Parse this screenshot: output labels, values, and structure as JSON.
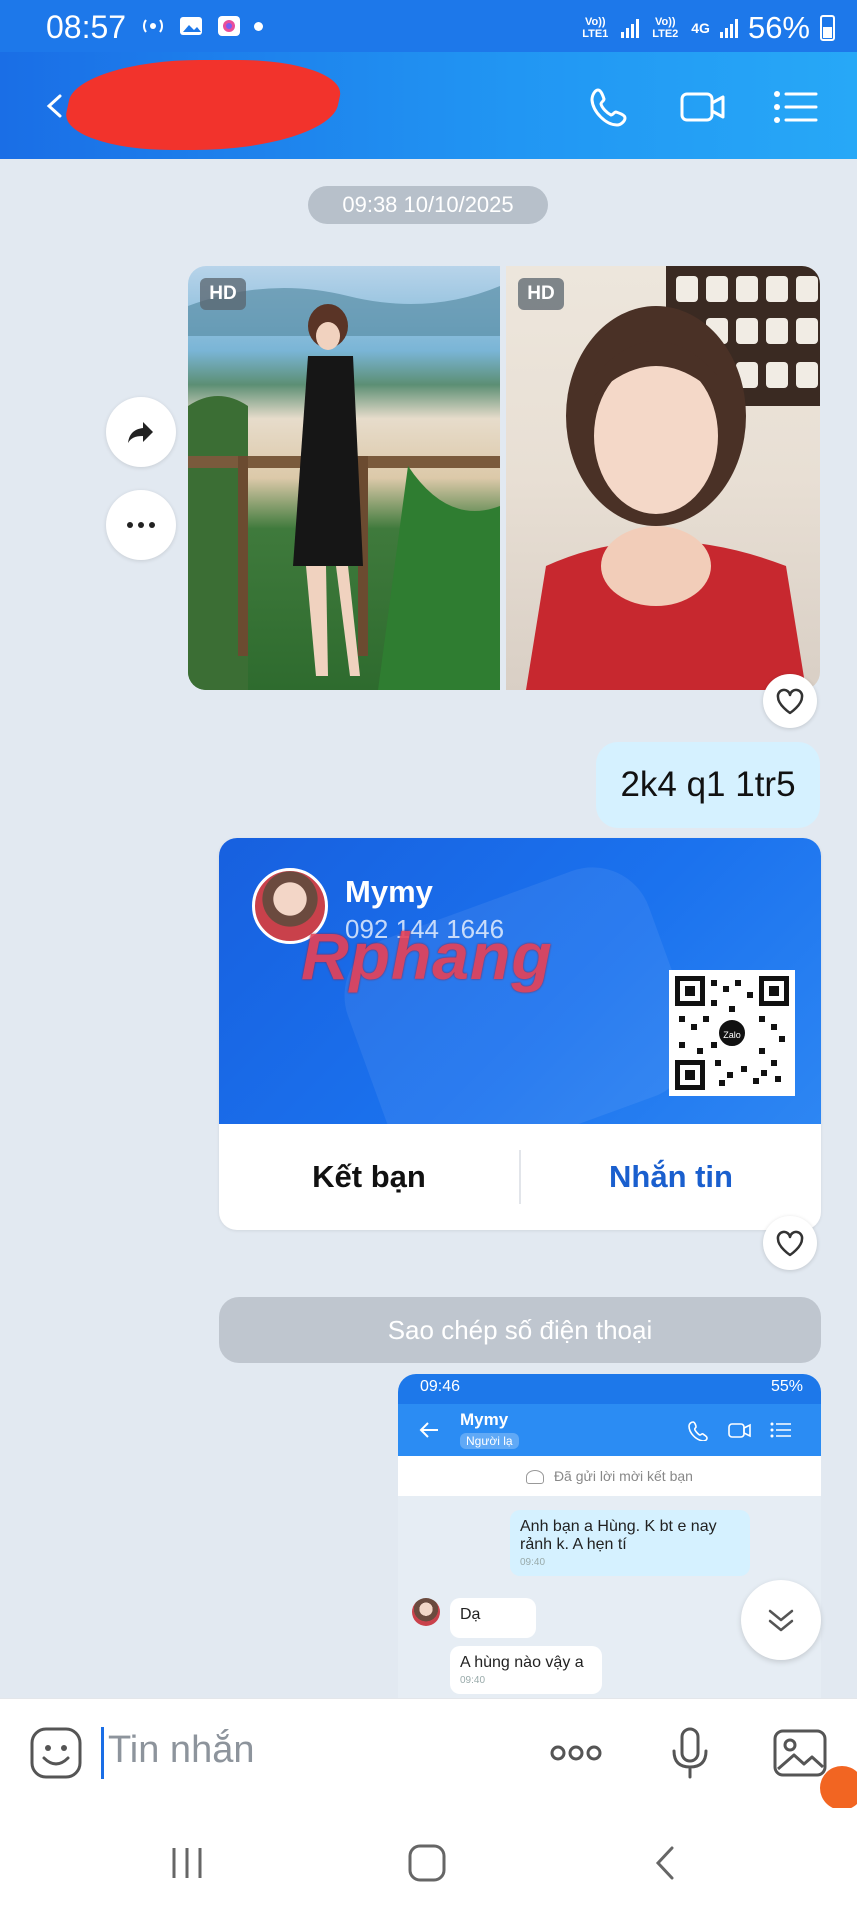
{
  "status_bar": {
    "time": "08:57",
    "sim1_label": "Vo)) LTE1",
    "sim2_label": "Vo)) LTE2",
    "network": "4G",
    "battery": "56%"
  },
  "header": {
    "contact_name_redacted": true,
    "icons": [
      "back-arrow-icon",
      "phone-icon",
      "video-icon",
      "menu-list-icon"
    ]
  },
  "chat": {
    "timestamp": "09:38 10/10/2025",
    "photos": [
      {
        "badge": "HD"
      },
      {
        "badge": "HD"
      }
    ],
    "message_text": "2k4 q1 1tr5",
    "contact_card": {
      "name": "Mymy",
      "phone": "092 144 1646",
      "watermark": "Rphang",
      "qr_logo": "Zalo",
      "add_friend_label": "Kết bạn",
      "message_label": "Nhắn tin"
    },
    "copy_phone_label": "Sao chép số điện thoại",
    "embedded_screenshot": {
      "time": "09:46",
      "battery": "55%",
      "contact_name": "Mymy",
      "contact_tag": "Người lạ",
      "friend_request_note": "Đã gửi lời mời kết bạn",
      "messages": [
        {
          "text": "Anh bạn a Hùng. K bt e nay rảnh k. A hẹn tí",
          "time": "09:40",
          "side": "sent"
        },
        {
          "text": "Dạ",
          "time": "",
          "side": "received"
        },
        {
          "text": "A hùng nào vậy a",
          "time": "09:40",
          "side": "received"
        }
      ]
    }
  },
  "input_bar": {
    "placeholder": "Tin nhắn"
  },
  "colors": {
    "accent": "#1a6ee6",
    "chat_background": "#e2e9f1",
    "sent_bubble": "#d5f1ff",
    "card_blue": "#1b72ee"
  }
}
